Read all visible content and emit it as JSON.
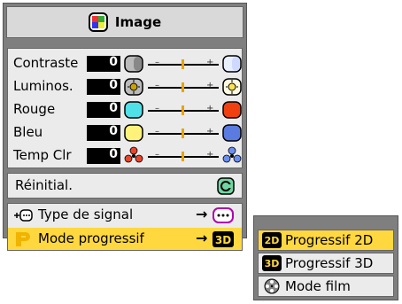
{
  "menu": {
    "title": "Image",
    "sliders": [
      {
        "label": "Contraste",
        "value": "0",
        "icon_left": "contrast-low-icon",
        "icon_right": "contrast-high-icon"
      },
      {
        "label": "Luminos.",
        "value": "0",
        "icon_left": "brightness-low-icon",
        "icon_right": "brightness-high-icon"
      },
      {
        "label": "Rouge",
        "value": "0",
        "icon_left": "red-low-icon",
        "icon_right": "red-high-icon"
      },
      {
        "label": "Bleu",
        "value": "0",
        "icon_left": "blue-low-icon",
        "icon_right": "blue-high-icon"
      },
      {
        "label": "Temp Clr",
        "value": "0",
        "icon_left": "color-temp-warm-icon",
        "icon_right": "color-temp-cool-icon"
      }
    ],
    "slider_minus": "–",
    "slider_plus": "+",
    "reset_label": "Réinitial.",
    "signal_type_label": "Type de signal",
    "progressive_mode_label": "Mode progressif",
    "arrow": "→"
  },
  "submenu": {
    "items": [
      {
        "label": "Progressif 2D",
        "icon": "2d-icon",
        "selected": true
      },
      {
        "label": "Progressif 3D",
        "icon": "3d-icon",
        "selected": false
      },
      {
        "label": "Mode film",
        "icon": "film-reel-icon",
        "selected": false
      }
    ],
    "icon_2d_text": "2D",
    "icon_3d_text": "3D"
  },
  "colors": {
    "panel_bg": "#7f7f7f",
    "item_bg": "#ebebeb",
    "highlight": "#ffd840",
    "value_box": "#000000",
    "slider_tick": "#e8a300"
  }
}
